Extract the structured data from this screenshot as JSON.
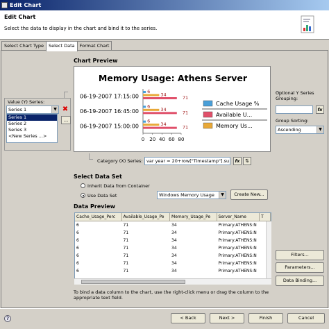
{
  "window": {
    "title": "Edit Chart"
  },
  "header": {
    "title": "Edit Chart",
    "description": "Select the data to display in the chart and bind it to the series."
  },
  "tabs": [
    {
      "label": "Select Chart Type",
      "active": false
    },
    {
      "label": "Select Data",
      "active": true
    },
    {
      "label": "Format Chart",
      "active": false
    }
  ],
  "chart_preview": {
    "section_title": "Chart Preview",
    "chart_title": "Memory Usage: Athens Server"
  },
  "chart_data": {
    "type": "bar",
    "orientation": "horizontal",
    "title": "Memory Usage: Athens Server",
    "categories": [
      "06-19-2007 17:15:00",
      "06-19-2007 16:45:00",
      "06-19-2007 15:00:00"
    ],
    "series": [
      {
        "name": "Cache Usage %",
        "color": "#4a9fd8",
        "values": [
          6,
          6,
          6
        ]
      },
      {
        "name": "Available U...",
        "color": "#e0506a",
        "values": [
          71,
          71,
          71
        ]
      },
      {
        "name": "Memory Us...",
        "color": "#e8a838",
        "values": [
          34,
          34,
          34
        ]
      }
    ],
    "xticks": [
      "0",
      "20",
      "40",
      "60",
      "80"
    ],
    "xlim": [
      0,
      80
    ],
    "legend_position": "right"
  },
  "value_series": {
    "label": "Value (Y) Series:",
    "selected": "Series 1",
    "options": [
      "Series 1",
      "Series 2",
      "Series 3",
      "<New Series ...>"
    ],
    "more_button": "..."
  },
  "optional_grouping": {
    "label": "Optional Y Series Grouping:",
    "fx_label": "fx",
    "sorting_label": "Group Sorting:",
    "sorting_value": "Ascending"
  },
  "category_series": {
    "label": "Category (X) Series:",
    "expression": "var year = 20+row[\"Timestamp\"].su",
    "fx_label": "fx"
  },
  "data_set": {
    "section_title": "Select Data Set",
    "inherit_label": "Inherit Data from Container",
    "use_label": "Use Data Set",
    "dataset_value": "Windows Memory Usage",
    "create_button": "Create New..."
  },
  "data_preview": {
    "section_title": "Data Preview",
    "columns": [
      "Cache_Usage_Perc",
      "Available_Usage_Pe",
      "Memory_Usage_Pe",
      "Server_Name",
      "T"
    ],
    "rows": [
      [
        "6",
        "71",
        "34",
        "Primary:ATHENS:N",
        ""
      ],
      [
        "6",
        "71",
        "34",
        "Primary:ATHENS:N",
        ""
      ],
      [
        "6",
        "71",
        "34",
        "Primary:ATHENS:N",
        ""
      ],
      [
        "6",
        "71",
        "34",
        "Primary:ATHENS:N",
        ""
      ],
      [
        "6",
        "71",
        "34",
        "Primary:ATHENS:N",
        ""
      ],
      [
        "6",
        "71",
        "34",
        "Primary:ATHENS:N",
        ""
      ],
      [
        "6",
        "71",
        "34",
        "Primary:ATHENS:N",
        ""
      ]
    ],
    "hint": "To bind a data column to the chart, use the right-click menu or drag the column to the appropriate text field."
  },
  "side_buttons": {
    "filters": "Filters...",
    "parameters": "Parameters...",
    "data_binding": "Data Binding..."
  },
  "footer": {
    "back": "< Back",
    "next": "Next >",
    "finish": "Finish",
    "cancel": "Cancel"
  }
}
